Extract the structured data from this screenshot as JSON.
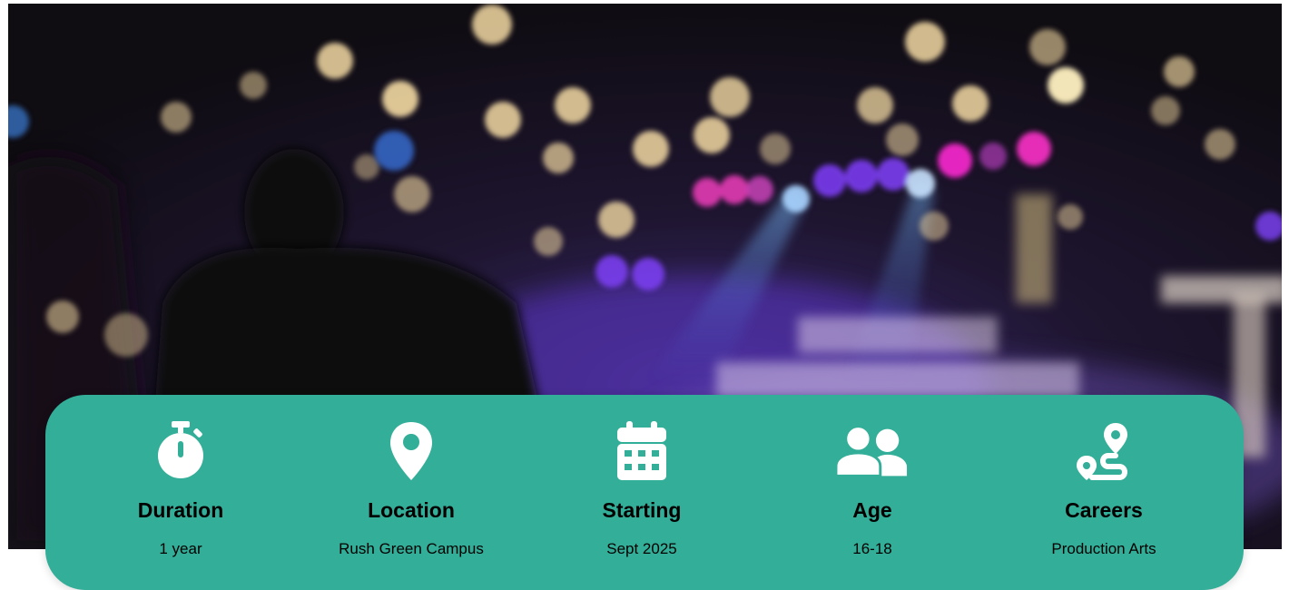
{
  "hero": {
    "image": "concert-stage-bokeh"
  },
  "info_bar": {
    "background": "#33ae98",
    "items": [
      {
        "icon": "stopwatch-icon",
        "title": "Duration",
        "value": "1 year"
      },
      {
        "icon": "location-pin-icon",
        "title": "Location",
        "value": "Rush Green Campus"
      },
      {
        "icon": "calendar-icon",
        "title": "Starting",
        "value": "Sept 2025"
      },
      {
        "icon": "users-icon",
        "title": "Age",
        "value": "16-18"
      },
      {
        "icon": "route-icon",
        "title": "Careers",
        "value": "Production Arts"
      }
    ]
  }
}
